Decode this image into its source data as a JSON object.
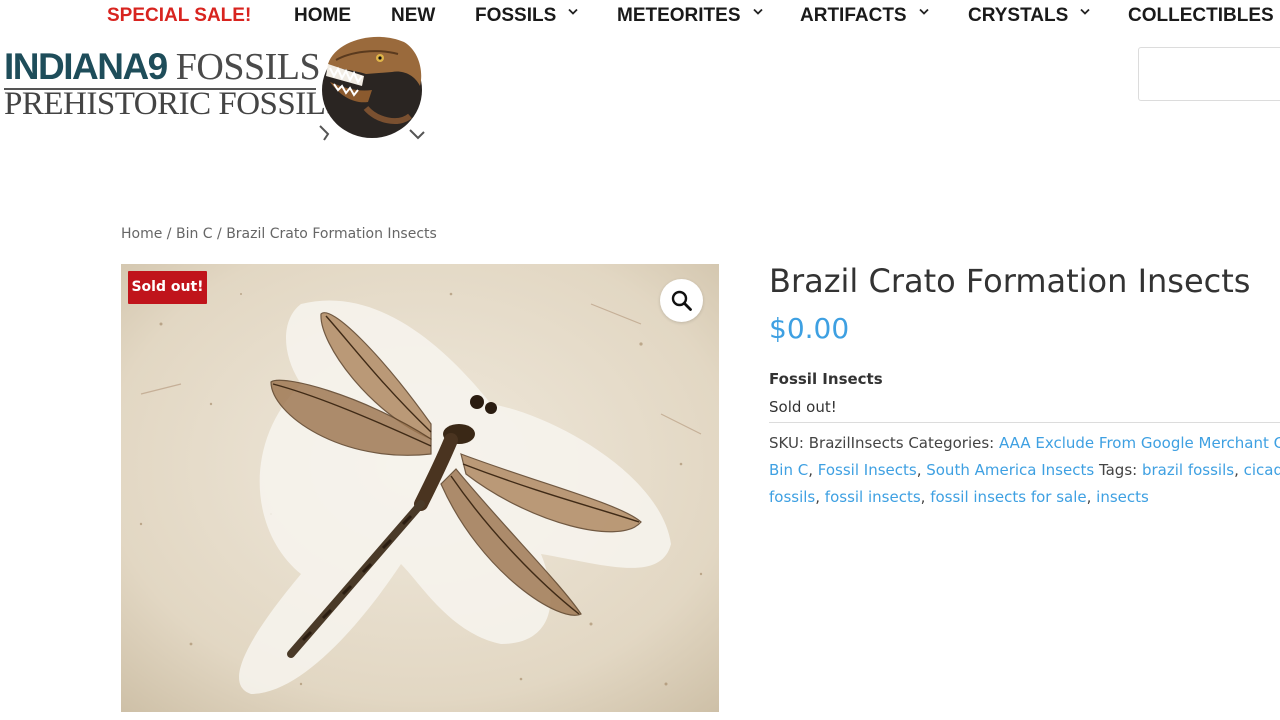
{
  "nav": {
    "items": [
      {
        "label": "SPECIAL SALE!",
        "dropdown": false,
        "color": "#d8241f"
      },
      {
        "label": "HOME",
        "dropdown": false
      },
      {
        "label": "NEW",
        "dropdown": false
      },
      {
        "label": "FOSSILS",
        "dropdown": true
      },
      {
        "label": "METEORITES",
        "dropdown": true
      },
      {
        "label": "ARTIFACTS",
        "dropdown": true
      },
      {
        "label": "CRYSTALS",
        "dropdown": true
      },
      {
        "label": "COLLECTIBLES",
        "dropdown": true
      }
    ]
  },
  "logo": {
    "brand": "INDIANA9",
    "line1_rest": " FOSSILS",
    "line2": "PREHISTORIC FOSSILS",
    "icon": "t-rex-head-icon"
  },
  "search": {
    "placeholder": ""
  },
  "breadcrumb": {
    "home": "Home",
    "sep1": " / ",
    "bin": "Bin C",
    "sep2": " / ",
    "current": "Brazil Crato Formation Insects"
  },
  "product": {
    "badge": "Sold out!",
    "zoom_icon": "magnifier-icon",
    "title": "Brazil Crato Formation Insects",
    "price": "$0.00",
    "short_heading": "Fossil Insects",
    "stock": "Sold out!",
    "meta": {
      "sku_label": "SKU: ",
      "sku": "BrazilInsects",
      "categories_label": " Categories: ",
      "categories": [
        "AAA Exclude From Google Merchant Center",
        "Bin C",
        "Fossil Insects",
        "South America Insects"
      ],
      "tags_label": " Tags: ",
      "tags": [
        "brazil fossils",
        "cicada",
        "fossils",
        "fossil insects",
        "fossil insects for sale",
        "insects"
      ],
      "comma": ", "
    }
  },
  "colors": {
    "link": "#3ea0e2",
    "badge": "#c0141b",
    "sale": "#d8241f",
    "logo_brand": "#1e4d5a"
  }
}
